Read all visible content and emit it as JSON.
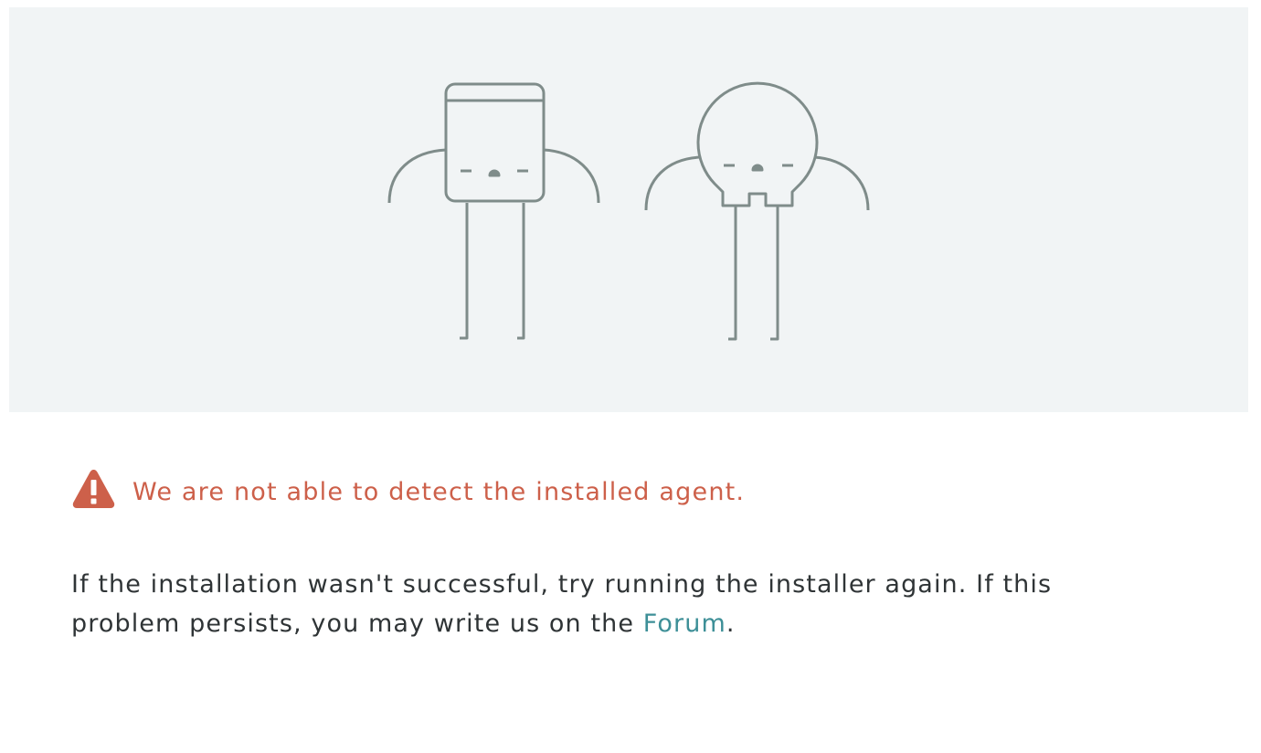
{
  "illustration": {
    "figures": [
      "box-robot-illustration",
      "round-head-robot-illustration"
    ]
  },
  "alert": {
    "icon": "warning-icon",
    "message": "We are not able to detect the installed agent."
  },
  "help": {
    "text_line": "If the installation wasn't successful, try running the installer again. If this problem persists, you may write us on the ",
    "link_label": "Forum",
    "trailing": "."
  },
  "colors": {
    "error": "#cd604a",
    "link": "#3d8f97",
    "body_text": "#2f3436",
    "hero_bg": "#f1f4f5",
    "line_art": "#7f8c8a"
  }
}
